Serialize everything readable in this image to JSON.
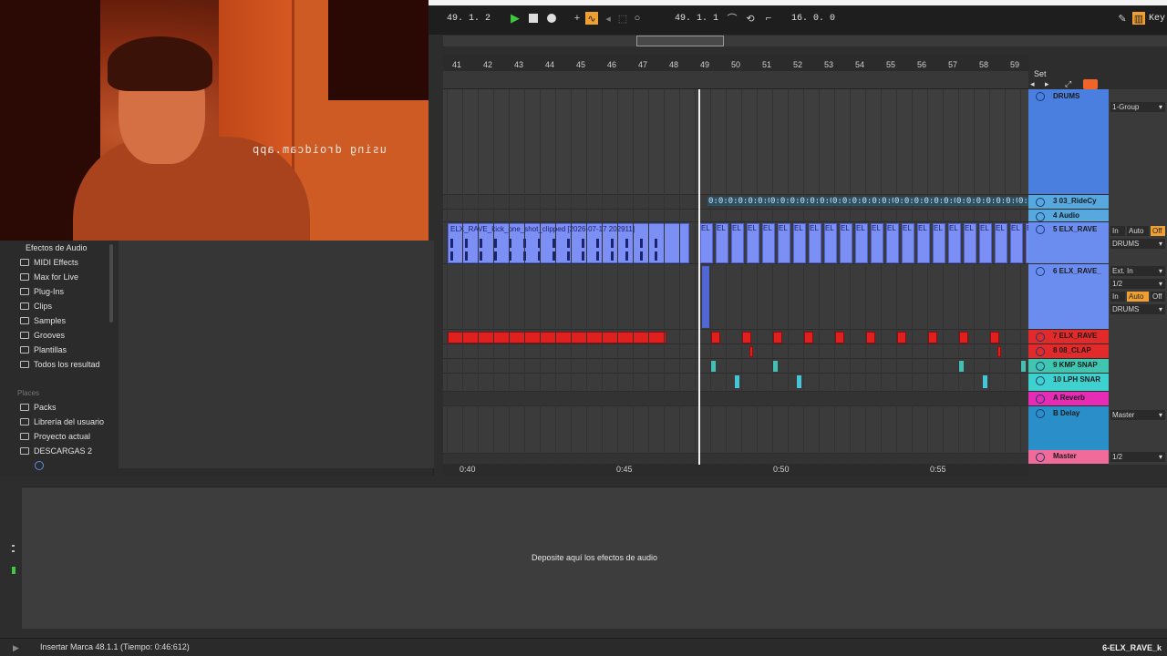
{
  "webcam": {
    "caption": "using droidcam.app"
  },
  "transport": {
    "position": "49.  1.  2",
    "loop_start": "49.  1.  1",
    "loop_length": "16.  0.  0",
    "key_label": "Key"
  },
  "ruler": {
    "bars": [
      "41",
      "42",
      "43",
      "44",
      "45",
      "46",
      "47",
      "48",
      "49",
      "50",
      "51",
      "52",
      "53",
      "54",
      "55",
      "56",
      "57",
      "58",
      "59"
    ],
    "times": [
      "0:40",
      "0:45",
      "0:50",
      "0:55"
    ],
    "set_label": "Set"
  },
  "arrangement": {
    "kick_clip_label": "ELX_RAVE_kick_one_shot_clipped [2026-07-17 202911]",
    "ride_label": "0:0:0:0:0:0:0",
    "small_clip_label": "EL"
  },
  "tracks": [
    {
      "name": "DRUMS",
      "color": "#4a7fe0",
      "io": "1-Group"
    },
    {
      "name": "3 03_RideCy",
      "color": "#58a8e0"
    },
    {
      "name": "4 Audio",
      "color": "#58a8e0"
    },
    {
      "name": "5 ELX_RAVE",
      "color": "#6c8df0",
      "io_in": "In",
      "io_auto": "Auto",
      "io_off": "Off",
      "io_out": "DRUMS"
    },
    {
      "name": "6 ELX_RAVE_",
      "color": "#6c8df0",
      "io_in_source": "Ext. In",
      "io_channel": "1/2",
      "io_in": "In",
      "io_auto": "Auto",
      "io_off": "Off",
      "io_out": "DRUMS"
    },
    {
      "name": "7 ELX_RAVE",
      "color": "#e22a2a"
    },
    {
      "name": "8 08_CLAP",
      "color": "#e22a2a"
    },
    {
      "name": "9 KMP SNAP",
      "color": "#3fc5b0"
    },
    {
      "name": "10 LPH SNAR",
      "color": "#3fd0d0"
    },
    {
      "name": "A Reverb",
      "color": "#e62cb5"
    },
    {
      "name": "B Delay",
      "color": "#2a8fc9",
      "io": "Master"
    },
    {
      "name": "Master",
      "color": "#f06a9a",
      "io": "1/2"
    }
  ],
  "browser": {
    "categories": [
      "Efectos de Audio",
      "MIDI Effects",
      "Max for Live",
      "Plug-Ins",
      "Clips",
      "Samples",
      "Grooves",
      "Plantillas",
      "Todos los resultad"
    ],
    "places_header": "Places",
    "places": [
      "Packs",
      "Librería del usuario",
      "Proyecto actual",
      "DESCARGAS 2"
    ]
  },
  "device_view": {
    "hint": "Deposite aquí los efectos de audio"
  },
  "status": {
    "message": "Insertar Marca 48.1.1 (Tiempo: 0:46:612)",
    "track": "6-ELX_RAVE_k"
  },
  "colors": {
    "accent": "#f0a030",
    "play": "#3ec83e",
    "selected_track": "#4a7fe0"
  }
}
